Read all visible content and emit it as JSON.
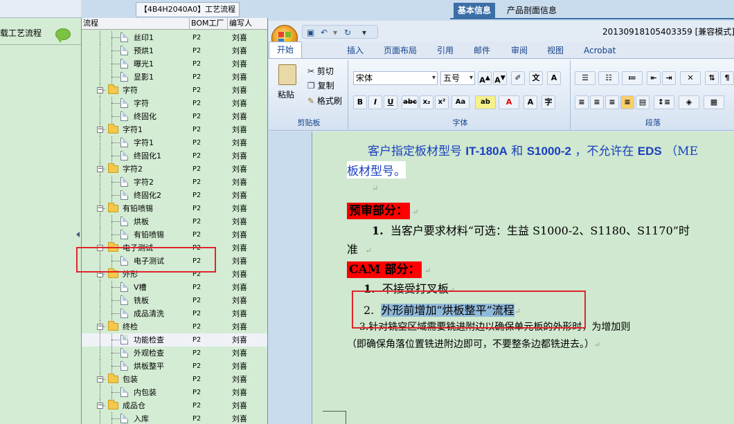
{
  "left_panel": {
    "item_label": "载工艺流程",
    "bubble_icon": "speech-bubble-icon"
  },
  "process_tab": {
    "title": "【4B4H2040A0】工艺流程"
  },
  "tree": {
    "headers": {
      "col1": "流程",
      "col2": "BOM工厂",
      "col3": "编写人"
    },
    "rows": [
      {
        "label": "丝印1",
        "bom": "P2",
        "writer": "刘喜",
        "type": "doc"
      },
      {
        "label": "预烘1",
        "bom": "P2",
        "writer": "刘喜",
        "type": "doc"
      },
      {
        "label": "曝光1",
        "bom": "P2",
        "writer": "刘喜",
        "type": "doc"
      },
      {
        "label": "显影1",
        "bom": "P2",
        "writer": "刘喜",
        "type": "doc"
      },
      {
        "label": "字符",
        "bom": "P2",
        "writer": "刘喜",
        "type": "folder"
      },
      {
        "label": "字符",
        "bom": "P2",
        "writer": "刘喜",
        "type": "doc"
      },
      {
        "label": "终固化",
        "bom": "P2",
        "writer": "刘喜",
        "type": "doc"
      },
      {
        "label": "字符1",
        "bom": "P2",
        "writer": "刘喜",
        "type": "folder"
      },
      {
        "label": "字符1",
        "bom": "P2",
        "writer": "刘喜",
        "type": "doc"
      },
      {
        "label": "终固化1",
        "bom": "P2",
        "writer": "刘喜",
        "type": "doc"
      },
      {
        "label": "字符2",
        "bom": "P2",
        "writer": "刘喜",
        "type": "folder"
      },
      {
        "label": "字符2",
        "bom": "P2",
        "writer": "刘喜",
        "type": "doc"
      },
      {
        "label": "终固化2",
        "bom": "P2",
        "writer": "刘喜",
        "type": "doc"
      },
      {
        "label": "有铅喷锡",
        "bom": "P2",
        "writer": "刘喜",
        "type": "folder"
      },
      {
        "label": "烘板",
        "bom": "P2",
        "writer": "刘喜",
        "type": "doc"
      },
      {
        "label": "有铅喷锡",
        "bom": "P2",
        "writer": "刘喜",
        "type": "doc"
      },
      {
        "label": "电子测试",
        "bom": "P2",
        "writer": "刘喜",
        "type": "folder"
      },
      {
        "label": "电子测试",
        "bom": "P2",
        "writer": "刘喜",
        "type": "doc"
      },
      {
        "label": "外形",
        "bom": "P2",
        "writer": "刘喜",
        "type": "folder"
      },
      {
        "label": "V槽",
        "bom": "P2",
        "writer": "刘喜",
        "type": "doc"
      },
      {
        "label": "铣板",
        "bom": "P2",
        "writer": "刘喜",
        "type": "doc"
      },
      {
        "label": "成品清洗",
        "bom": "P2",
        "writer": "刘喜",
        "type": "doc"
      },
      {
        "label": "终检",
        "bom": "P2",
        "writer": "刘喜",
        "type": "folder"
      },
      {
        "label": "功能检查",
        "bom": "P2",
        "writer": "刘喜",
        "type": "doc",
        "selected": true
      },
      {
        "label": "外观检查",
        "bom": "P2",
        "writer": "刘喜",
        "type": "doc"
      },
      {
        "label": "烘板整平",
        "bom": "P2",
        "writer": "刘喜",
        "type": "doc"
      },
      {
        "label": "包装",
        "bom": "P2",
        "writer": "刘喜",
        "type": "folder"
      },
      {
        "label": "内包装",
        "bom": "P2",
        "writer": "刘喜",
        "type": "doc"
      },
      {
        "label": "成品仓",
        "bom": "P2",
        "writer": "刘喜",
        "type": "folder"
      },
      {
        "label": "入库",
        "bom": "P2",
        "writer": "刘喜",
        "type": "doc"
      }
    ]
  },
  "right_tabs": {
    "basic_info": "基本信息",
    "product_section_info": "产品剖面信息"
  },
  "word": {
    "title": "20130918105403359 [兼容模式] -",
    "ribbon_tabs": [
      "开始",
      "插入",
      "页面布局",
      "引用",
      "邮件",
      "审阅",
      "视图",
      "Acrobat"
    ],
    "clipboard": {
      "paste": "粘贴",
      "cut": "剪切",
      "copy": "复制",
      "format_painter": "格式刷",
      "group": "剪贴板"
    },
    "font": {
      "name": "宋体",
      "size": "五号",
      "group": "字体"
    },
    "paragraph": {
      "group": "段落"
    },
    "document": {
      "line1_a": "客户指定板材型号",
      "line1_b": "IT-180A",
      "line1_c": "和",
      "line1_d": "S1000-2",
      "line1_e": "，不允许在",
      "line1_f": "EDS",
      "line1_g": "（ME",
      "line2": "板材型号。",
      "section_prereview": "预审部分：",
      "item1_num": "1.",
      "item1_text": "当客户要求材料“可选：生益 S1000-2、S1180、S1170”时",
      "item1_cont": "准",
      "section_cam": "CAM 部分：",
      "cam1_num": "1.",
      "cam1_text": "不接受打叉板",
      "cam2_num": "2.",
      "cam2_text": "外形前增加“烘板整平”流程",
      "cam3_text": "3.针对铣空区域需要铣进附边以确保单元板的外形时，为增加则",
      "cam3_cont": "（即确保角落位置铣进附边即可，不要整条边都铣进去。）"
    }
  }
}
